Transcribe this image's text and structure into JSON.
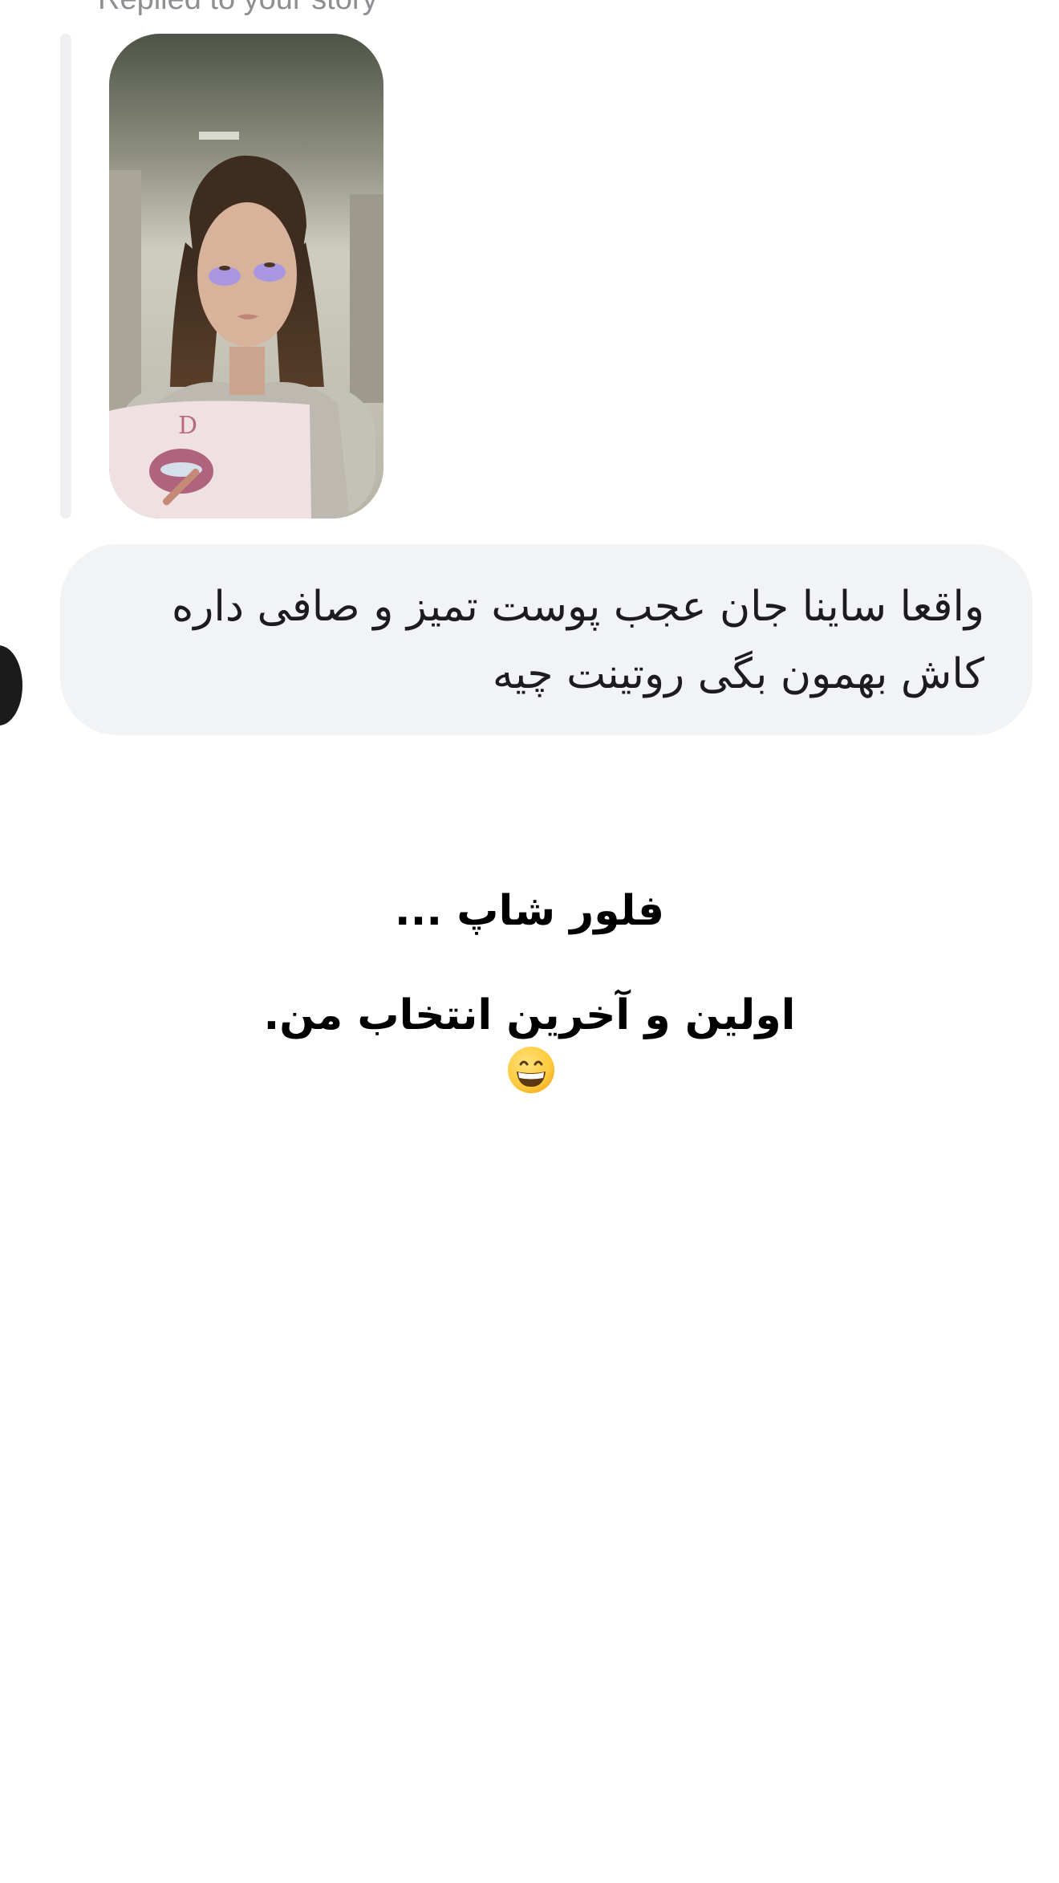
{
  "story_reply": {
    "label": "Replied to your story"
  },
  "message": {
    "lines": [
      "واقعا ساینا جان عجب پوست تمیز و صافی داره",
      "کاش بهمون بگی روتینت چیه"
    ]
  },
  "overlay": {
    "line1": "فلور شاپ ...",
    "line2": "اولین و آخرین انتخاب من."
  },
  "icons": {
    "avatar": "sender-avatar",
    "emoji": "grinning-face-icon"
  },
  "colors": {
    "bubble_background": "#f2f3f5",
    "story_bar": "#efeff1",
    "label_gray": "#8e8e93",
    "text": "#1c1c1e"
  }
}
